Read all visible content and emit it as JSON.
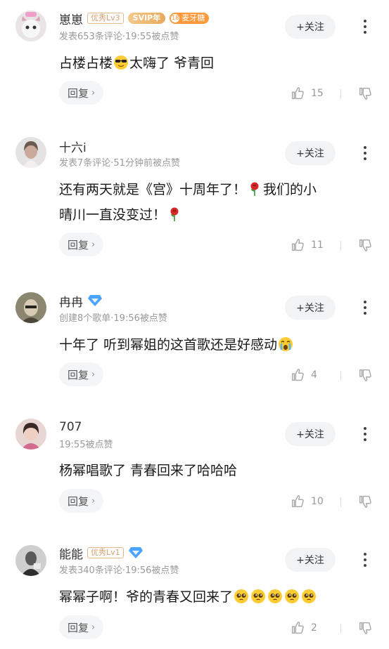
{
  "follow_label": "+关注",
  "reply_label": "回复",
  "reply_chevron": "›",
  "colors": {
    "accent": "#ff9a3c",
    "meta_text": "#9a9a9a",
    "button_bg": "#f2f3f5",
    "vip_blue": "#4aa3ff"
  },
  "comments": [
    {
      "user": "崽崽",
      "level_badge": "优秀Lv3",
      "svip_badge": "SVIP年",
      "fan_badge_level": "18",
      "fan_badge_name": "麦牙糖",
      "meta": "发表653条评论·19:55被点赞",
      "content_parts": [
        "占楼占楼",
        "太嗨了 爷青回"
      ],
      "emojis": [
        "cool-sunglasses-emoji"
      ],
      "likes": "15"
    },
    {
      "user": "十六i",
      "meta": "发表7条评论·51分钟前被点赞",
      "content_line1a": "还有两天就是《宫》十周年了！",
      "content_line1b": "我们的小",
      "content_line2": "晴川一直没变过！",
      "emojis": [
        "rose-emoji",
        "rose-emoji"
      ],
      "likes": "11"
    },
    {
      "user": "冉冉",
      "vip_icon": "diamond-vip-icon",
      "meta": "创建8个歌单·19:56被点赞",
      "content": "十年了 听到幂姐的这首歌还是好感动",
      "emojis": [
        "crying-emoji"
      ],
      "likes": "4"
    },
    {
      "user": "707",
      "meta": "19:55被点赞",
      "content": "杨幂唱歌了  青春回来了哈哈哈",
      "likes": "10"
    },
    {
      "user": "能能",
      "level_badge": "优秀Lv1",
      "vip_icon": "diamond-vip-icon",
      "meta": "发表340条评论·19:56被点赞",
      "content": "幂幂子啊！爷的青春又回来了",
      "emojis": [
        "pleading-emoji",
        "pleading-emoji",
        "pleading-emoji",
        "pleading-emoji",
        "pleading-emoji"
      ],
      "likes": "2"
    }
  ]
}
